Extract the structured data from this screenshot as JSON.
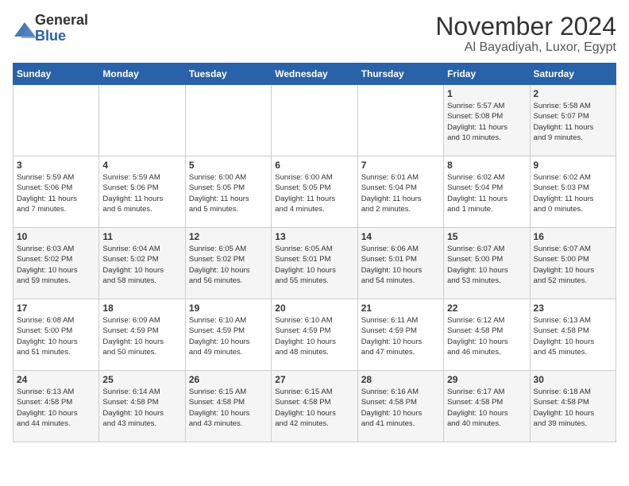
{
  "header": {
    "logo_general": "General",
    "logo_blue": "Blue",
    "month_title": "November 2024",
    "location": "Al Bayadiyah, Luxor, Egypt"
  },
  "weekdays": [
    "Sunday",
    "Monday",
    "Tuesday",
    "Wednesday",
    "Thursday",
    "Friday",
    "Saturday"
  ],
  "weeks": [
    [
      {
        "day": "",
        "info": ""
      },
      {
        "day": "",
        "info": ""
      },
      {
        "day": "",
        "info": ""
      },
      {
        "day": "",
        "info": ""
      },
      {
        "day": "",
        "info": ""
      },
      {
        "day": "1",
        "info": "Sunrise: 5:57 AM\nSunset: 5:08 PM\nDaylight: 11 hours\nand 10 minutes."
      },
      {
        "day": "2",
        "info": "Sunrise: 5:58 AM\nSunset: 5:07 PM\nDaylight: 11 hours\nand 9 minutes."
      }
    ],
    [
      {
        "day": "3",
        "info": "Sunrise: 5:59 AM\nSunset: 5:06 PM\nDaylight: 11 hours\nand 7 minutes."
      },
      {
        "day": "4",
        "info": "Sunrise: 5:59 AM\nSunset: 5:06 PM\nDaylight: 11 hours\nand 6 minutes."
      },
      {
        "day": "5",
        "info": "Sunrise: 6:00 AM\nSunset: 5:05 PM\nDaylight: 11 hours\nand 5 minutes."
      },
      {
        "day": "6",
        "info": "Sunrise: 6:00 AM\nSunset: 5:05 PM\nDaylight: 11 hours\nand 4 minutes."
      },
      {
        "day": "7",
        "info": "Sunrise: 6:01 AM\nSunset: 5:04 PM\nDaylight: 11 hours\nand 2 minutes."
      },
      {
        "day": "8",
        "info": "Sunrise: 6:02 AM\nSunset: 5:04 PM\nDaylight: 11 hours\nand 1 minute."
      },
      {
        "day": "9",
        "info": "Sunrise: 6:02 AM\nSunset: 5:03 PM\nDaylight: 11 hours\nand 0 minutes."
      }
    ],
    [
      {
        "day": "10",
        "info": "Sunrise: 6:03 AM\nSunset: 5:02 PM\nDaylight: 10 hours\nand 59 minutes."
      },
      {
        "day": "11",
        "info": "Sunrise: 6:04 AM\nSunset: 5:02 PM\nDaylight: 10 hours\nand 58 minutes."
      },
      {
        "day": "12",
        "info": "Sunrise: 6:05 AM\nSunset: 5:02 PM\nDaylight: 10 hours\nand 56 minutes."
      },
      {
        "day": "13",
        "info": "Sunrise: 6:05 AM\nSunset: 5:01 PM\nDaylight: 10 hours\nand 55 minutes."
      },
      {
        "day": "14",
        "info": "Sunrise: 6:06 AM\nSunset: 5:01 PM\nDaylight: 10 hours\nand 54 minutes."
      },
      {
        "day": "15",
        "info": "Sunrise: 6:07 AM\nSunset: 5:00 PM\nDaylight: 10 hours\nand 53 minutes."
      },
      {
        "day": "16",
        "info": "Sunrise: 6:07 AM\nSunset: 5:00 PM\nDaylight: 10 hours\nand 52 minutes."
      }
    ],
    [
      {
        "day": "17",
        "info": "Sunrise: 6:08 AM\nSunset: 5:00 PM\nDaylight: 10 hours\nand 51 minutes."
      },
      {
        "day": "18",
        "info": "Sunrise: 6:09 AM\nSunset: 4:59 PM\nDaylight: 10 hours\nand 50 minutes."
      },
      {
        "day": "19",
        "info": "Sunrise: 6:10 AM\nSunset: 4:59 PM\nDaylight: 10 hours\nand 49 minutes."
      },
      {
        "day": "20",
        "info": "Sunrise: 6:10 AM\nSunset: 4:59 PM\nDaylight: 10 hours\nand 48 minutes."
      },
      {
        "day": "21",
        "info": "Sunrise: 6:11 AM\nSunset: 4:59 PM\nDaylight: 10 hours\nand 47 minutes."
      },
      {
        "day": "22",
        "info": "Sunrise: 6:12 AM\nSunset: 4:58 PM\nDaylight: 10 hours\nand 46 minutes."
      },
      {
        "day": "23",
        "info": "Sunrise: 6:13 AM\nSunset: 4:58 PM\nDaylight: 10 hours\nand 45 minutes."
      }
    ],
    [
      {
        "day": "24",
        "info": "Sunrise: 6:13 AM\nSunset: 4:58 PM\nDaylight: 10 hours\nand 44 minutes."
      },
      {
        "day": "25",
        "info": "Sunrise: 6:14 AM\nSunset: 4:58 PM\nDaylight: 10 hours\nand 43 minutes."
      },
      {
        "day": "26",
        "info": "Sunrise: 6:15 AM\nSunset: 4:58 PM\nDaylight: 10 hours\nand 43 minutes."
      },
      {
        "day": "27",
        "info": "Sunrise: 6:15 AM\nSunset: 4:58 PM\nDaylight: 10 hours\nand 42 minutes."
      },
      {
        "day": "28",
        "info": "Sunrise: 6:16 AM\nSunset: 4:58 PM\nDaylight: 10 hours\nand 41 minutes."
      },
      {
        "day": "29",
        "info": "Sunrise: 6:17 AM\nSunset: 4:58 PM\nDaylight: 10 hours\nand 40 minutes."
      },
      {
        "day": "30",
        "info": "Sunrise: 6:18 AM\nSunset: 4:58 PM\nDaylight: 10 hours\nand 39 minutes."
      }
    ]
  ]
}
